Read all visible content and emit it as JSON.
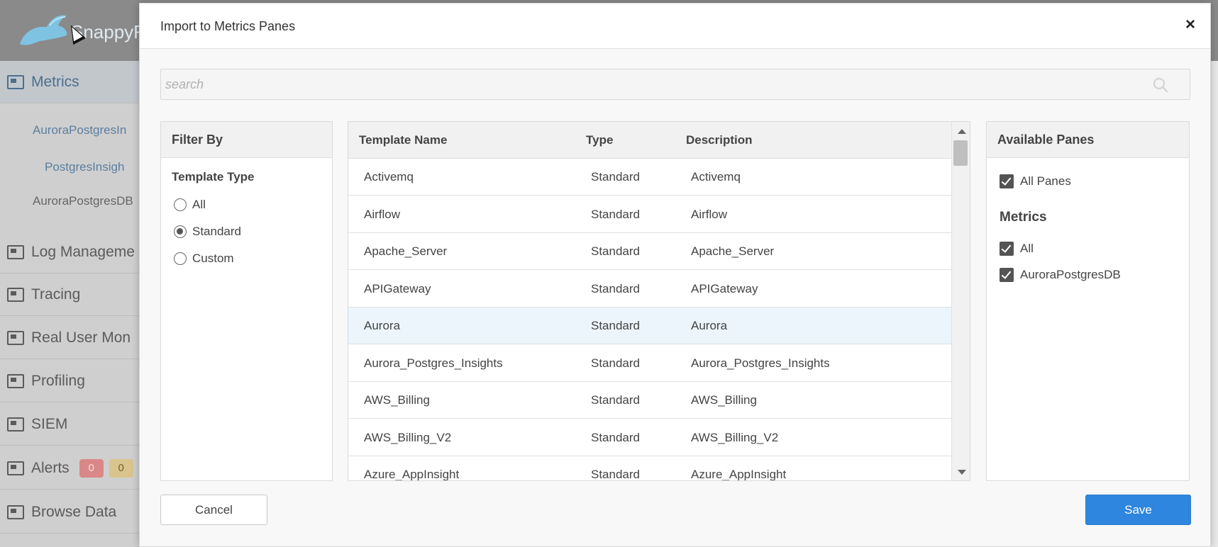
{
  "background_app": {
    "logo_text": "SnappyF",
    "sidebar": {
      "items": [
        {
          "label": "Metrics",
          "icon": "metrics-icon",
          "active": true
        },
        {
          "label": "Log Manageme",
          "icon": "log-icon"
        },
        {
          "label": "Tracing",
          "icon": "tracing-icon"
        },
        {
          "label": "Real User Mon",
          "icon": "rum-icon"
        },
        {
          "label": "Profiling",
          "icon": "profiling-icon"
        },
        {
          "label": "SIEM",
          "icon": "siem-icon"
        },
        {
          "label": "Alerts",
          "icon": "alerts-icon"
        },
        {
          "label": "Browse Data",
          "icon": "browse-icon"
        }
      ],
      "subitems": [
        "AuroraPostgresIn",
        "PostgresInsigh",
        "AuroraPostgresDB"
      ],
      "alert_badges": [
        "0",
        "0"
      ]
    }
  },
  "modal": {
    "title": "Import to Metrics Panes",
    "close_label": "×",
    "search": {
      "placeholder": "search",
      "value": ""
    },
    "filter": {
      "title": "Filter By",
      "subtitle": "Template Type",
      "options": [
        {
          "label": "All",
          "checked": false
        },
        {
          "label": "Standard",
          "checked": true
        },
        {
          "label": "Custom",
          "checked": false
        }
      ]
    },
    "table": {
      "columns": [
        "Template Name",
        "Type",
        "Description"
      ],
      "rows": [
        {
          "name": "Activemq",
          "type": "Standard",
          "description": "Activemq"
        },
        {
          "name": "Airflow",
          "type": "Standard",
          "description": "Airflow"
        },
        {
          "name": "Apache_Server",
          "type": "Standard",
          "description": "Apache_Server"
        },
        {
          "name": "APIGateway",
          "type": "Standard",
          "description": "APIGateway"
        },
        {
          "name": "Aurora",
          "type": "Standard",
          "description": "Aurora",
          "selected": true
        },
        {
          "name": "Aurora_Postgres_Insights",
          "type": "Standard",
          "description": "Aurora_Postgres_Insights"
        },
        {
          "name": "AWS_Billing",
          "type": "Standard",
          "description": "AWS_Billing"
        },
        {
          "name": "AWS_Billing_V2",
          "type": "Standard",
          "description": "AWS_Billing_V2"
        },
        {
          "name": "Azure_AppInsight",
          "type": "Standard",
          "description": "Azure_AppInsight"
        }
      ]
    },
    "panes": {
      "title": "Available Panes",
      "all_panes_label": "All Panes",
      "group_label": "Metrics",
      "group_items": [
        {
          "label": "All",
          "checked": true
        },
        {
          "label": "AuroraPostgresDB",
          "checked": true
        }
      ]
    },
    "cancel_label": "Cancel",
    "save_label": "Save"
  },
  "colors": {
    "primary": "#2e86de",
    "selected_row": "#ebf5fb",
    "active_nav": "#4c6f8d"
  }
}
